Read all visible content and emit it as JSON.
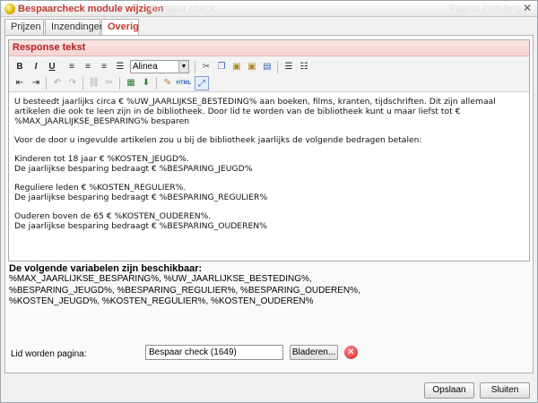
{
  "window": {
    "title": "Bespaarcheck module wijzigen",
    "ghost_left": "Bespaar check",
    "ghost_right": "Pagina instelling",
    "close_icon": "close-icon"
  },
  "tabs": [
    {
      "label": "Prijzen"
    },
    {
      "label": "Inzendingen"
    },
    {
      "label": "Overig"
    }
  ],
  "section": {
    "title": "Response tekst"
  },
  "toolbar": {
    "bold": "B",
    "italic": "I",
    "underline": "U",
    "format_select": "Alinea",
    "html_label": "HTML"
  },
  "editor": {
    "paragraphs": [
      "U besteedt jaarlijks circa € %UW_JAARLIJKSE_BESTEDING% aan boeken, films, kranten, tijdschriften. Dit zijn allemaal artikelen die ook te leen zijn in de bibliotheek. Door lid te worden van de bibliotheek kunt u maar liefst tot € %MAX_JAARLIJKSE_BESPARING% besparen",
      "Voor de door u ingevulde artikelen zou u bij de bibliotheek jaarlijks de volgende bedragen betalen:",
      "Kinderen tot 18 jaar € %KOSTEN_JEUGD%.",
      "De jaarlijkse besparing bedraagt € %BESPARING_JEUGD%",
      "Reguliere leden € %KOSTEN_REGULIER%.",
      "De jaarlijkse besparing bedraagt € %BESPARING_REGULIER%",
      "Ouderen boven de 65 € %KOSTEN_OUDEREN%.",
      "De jaarlijkse besparing bedraagt € %BESPARING_OUDEREN%"
    ]
  },
  "variables": {
    "heading": "De volgende variabelen zijn beschikbaar:",
    "line1": "%MAX_JAARLIJKSE_BESPARING%, %UW_JAARLIJKSE_BESTEDING%,",
    "line2": "%BESPARING_JEUGD%, %BESPARING_REGULIER%, %BESPARING_OUDEREN%,",
    "line3": "%KOSTEN_JEUGD%, %KOSTEN_REGULIER%, %KOSTEN_OUDEREN%"
  },
  "member_page": {
    "label": "Lid worden pagina:",
    "value": "Bespaar check (1649)",
    "browse_label": "Bladeren..."
  },
  "footer": {
    "save_label": "Opslaan",
    "close_label": "Sluiten"
  },
  "colors": {
    "accent": "#c0392b",
    "section_header_bg": "#f6d2d2"
  }
}
